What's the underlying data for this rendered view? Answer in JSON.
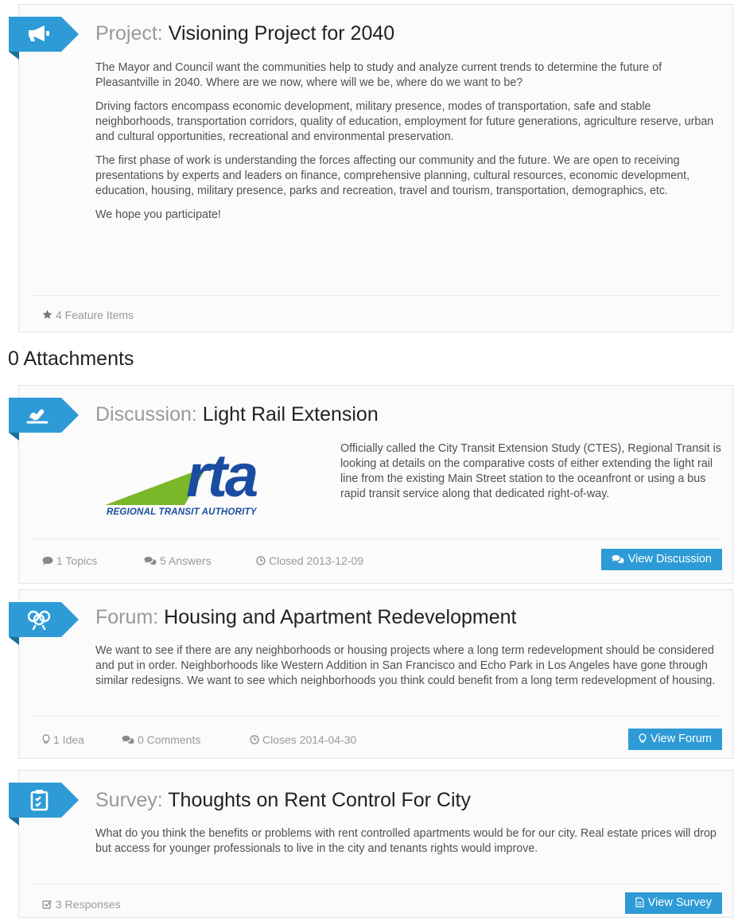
{
  "project": {
    "type_label": "Project:",
    "title": "Visioning Project for 2040",
    "paragraphs": [
      "The Mayor and Council want the communities help to study and analyze current trends to determine the future of Pleasantville in 2040. Where are we now, where will we be, where do we want to be?",
      "Driving factors encompass economic development, military presence, modes of transportation, safe and stable neighborhoods, transportation corridors, quality of education, employment for future generations, agriculture reserve, urban and cultural opportunities, recreational and environmental preservation.",
      "The first phase of work is understanding the forces affecting our community and the future. We are open to receiving presentations by experts and leaders on finance, comprehensive planning, cultural resources, economic development, education, housing, military presence, parks and recreation, travel and tourism, transportation, demographics, etc.",
      "We hope you participate!"
    ],
    "feature_items": "4 Feature Items",
    "icon": "megaphone-icon"
  },
  "attachments_heading": "0 Attachments",
  "discussion": {
    "type_label": "Discussion:",
    "title": "Light Rail Extension",
    "text": "Officially called the City Transit Extension Study (CTES), Regional Transit is looking at details on the comparative costs of either extending the light rail line from the existing Main Street station to the oceanfront or using a bus rapid transit service along that dedicated right-of-way.",
    "logo_text": "rta",
    "logo_caption": "REGIONAL TRANSIT AUTHORITY",
    "topics": "1 Topics",
    "answers": "5 Answers",
    "closed": "Closed 2013-12-09",
    "button": "View Discussion",
    "icon": "discussion-icon"
  },
  "forum": {
    "type_label": "Forum:",
    "title": "Housing and Apartment Redevelopment",
    "text": "We want to see if there are any neighborhoods or housing projects where a long term redevelopment should be considered and put in order. Neighborhoods like Western Addition in San Francisco and Echo Park in Los Angeles have gone through similar redesigns. We want to see which neighborhoods you think could benefit from a long term redevelopment of housing.",
    "ideas": "1 Idea",
    "comments": "0 Comments",
    "closes": "Closes 2014-04-30",
    "button": "View Forum",
    "icon": "forum-icon"
  },
  "survey": {
    "type_label": "Survey:",
    "title": "Thoughts on Rent Control For City",
    "text": "What do you think the benefits or problems with rent controlled apartments would be for our city. Real estate prices will drop but access for younger professionals to live in the city and tenants rights would improve.",
    "responses": "3 Responses",
    "button": "View Survey",
    "icon": "survey-icon"
  },
  "colors": {
    "accent": "#2e9bd6",
    "muted_text": "#9a9a9a",
    "logo_blue": "#1a4da0",
    "logo_green": "#7ab829"
  }
}
